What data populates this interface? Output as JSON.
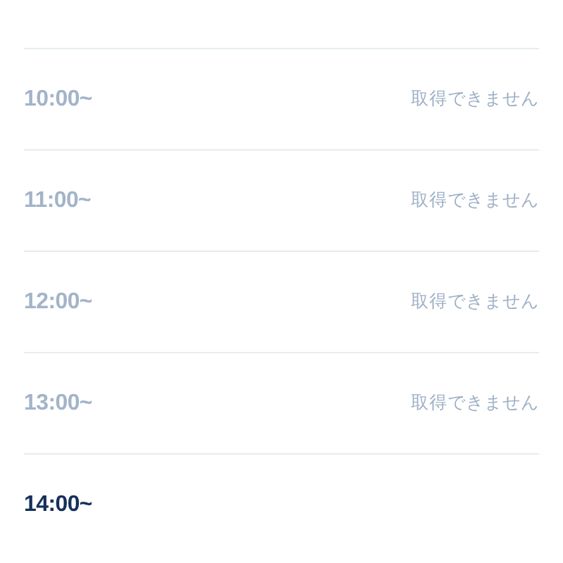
{
  "slots": [
    {
      "time": "10:00~",
      "available": false,
      "status": "取得できません"
    },
    {
      "time": "11:00~",
      "available": false,
      "status": "取得できません"
    },
    {
      "time": "12:00~",
      "available": false,
      "status": "取得できません"
    },
    {
      "time": "13:00~",
      "available": false,
      "status": "取得できません"
    },
    {
      "time": "14:00~",
      "available": true
    }
  ]
}
